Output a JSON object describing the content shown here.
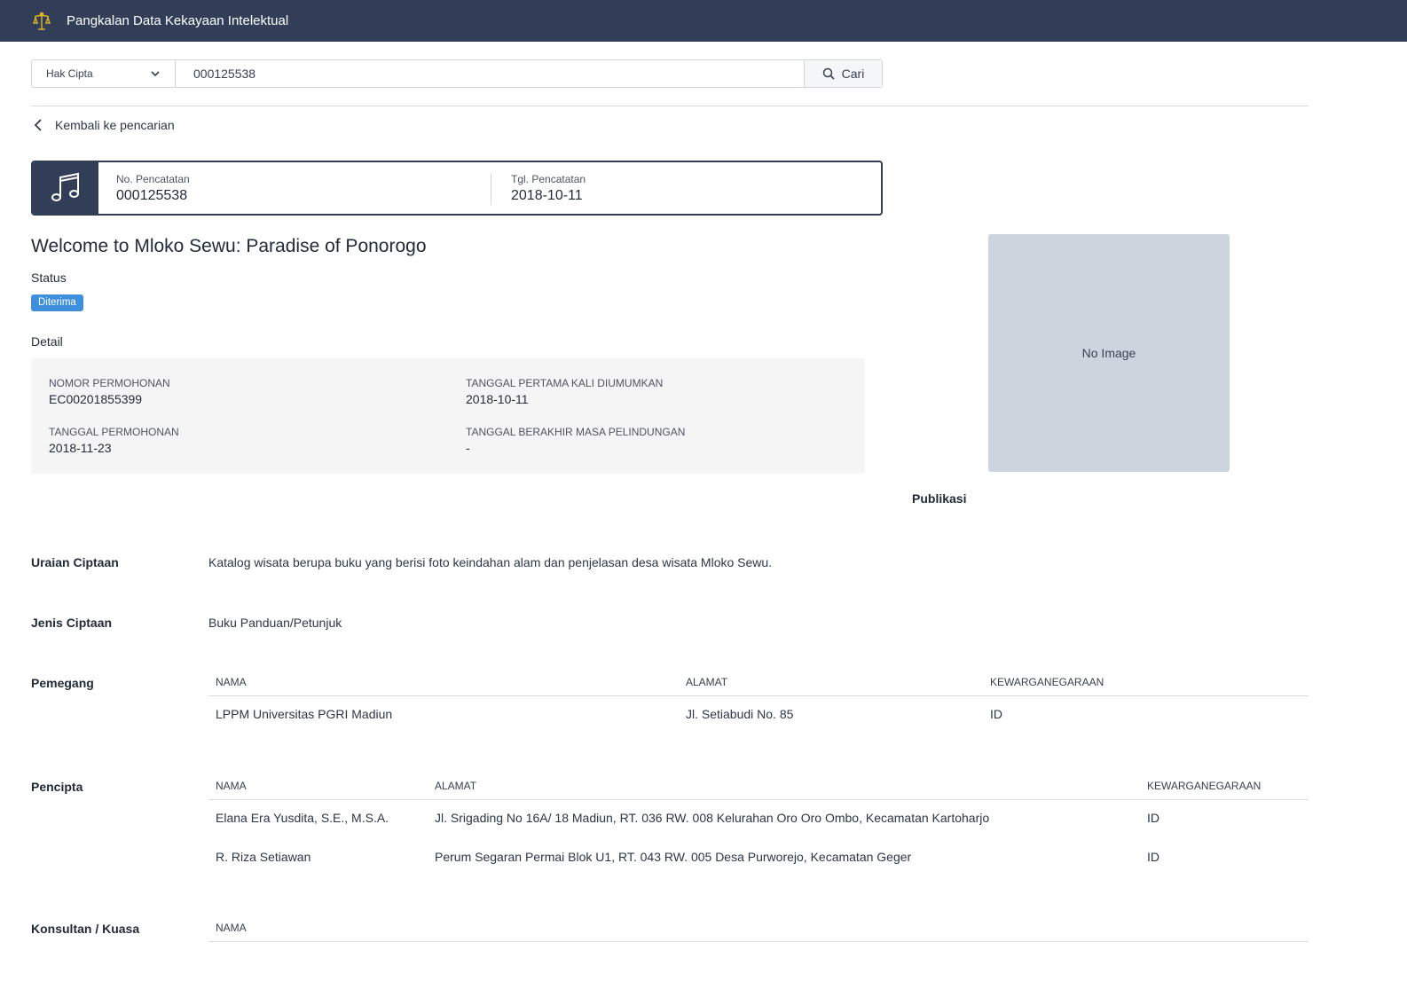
{
  "header": {
    "app_title": "Pangkalan Data Kekayaan Intelektual",
    "logo_icon": "emblem-icon"
  },
  "search": {
    "type_selected": "Hak Cipta",
    "query": "000125538",
    "button_label": "Cari"
  },
  "back_link": "Kembali ke pencarian",
  "record": {
    "icon": "music-note-icon",
    "no_label": "No. Pencatatan",
    "no_value": "000125538",
    "date_label": "Tgl. Pencatatan",
    "date_value": "2018-10-11"
  },
  "title": "Welcome to Mloko Sewu: Paradise of Ponorogo",
  "status": {
    "label": "Status",
    "value": "Diterima",
    "color": "#3f8fdf"
  },
  "detail": {
    "label": "Detail",
    "nomor_permohonan_label": "NOMOR PERMOHONAN",
    "nomor_permohonan": "EC00201855399",
    "tanggal_pertama_label": "TANGGAL PERTAMA KALI DIUMUMKAN",
    "tanggal_pertama": "2018-10-11",
    "tanggal_permohonan_label": "TANGGAL PERMOHONAN",
    "tanggal_permohonan": "2018-11-23",
    "tanggal_berakhir_label": "TANGGAL BERAKHIR MASA PELINDUNGAN",
    "tanggal_berakhir": "-"
  },
  "image_placeholder": "No Image",
  "publikasi_label": "Publikasi",
  "uraian": {
    "label": "Uraian Ciptaan",
    "value": "Katalog wisata berupa buku yang berisi foto keindahan alam dan penjelasan desa wisata Mloko Sewu."
  },
  "jenis": {
    "label": "Jenis Ciptaan",
    "value": "Buku Panduan/Petunjuk"
  },
  "pemegang": {
    "label": "Pemegang",
    "columns": [
      "NAMA",
      "ALAMAT",
      "KEWARGANEGARAAN"
    ],
    "rows": [
      [
        "LPPM Universitas PGRI Madiun",
        "Jl. Setiabudi No. 85",
        "ID"
      ]
    ]
  },
  "pencipta": {
    "label": "Pencipta",
    "columns": [
      "NAMA",
      "ALAMAT",
      "KEWARGANEGARAAN"
    ],
    "rows": [
      [
        "Elana Era Yusdita, S.E., M.S.A.",
        "Jl. Srigading No 16A/ 18 Madiun, RT. 036 RW. 008 Kelurahan Oro Oro Ombo, Kecamatan Kartoharjo",
        "ID"
      ],
      [
        "R. Riza Setiawan",
        "Perum Segaran Permai Blok U1, RT. 043 RW. 005 Desa Purworejo, Kecamatan Geger",
        "ID"
      ]
    ]
  },
  "konsultan": {
    "label": "Konsultan / Kuasa",
    "columns": [
      "NAMA"
    ]
  }
}
